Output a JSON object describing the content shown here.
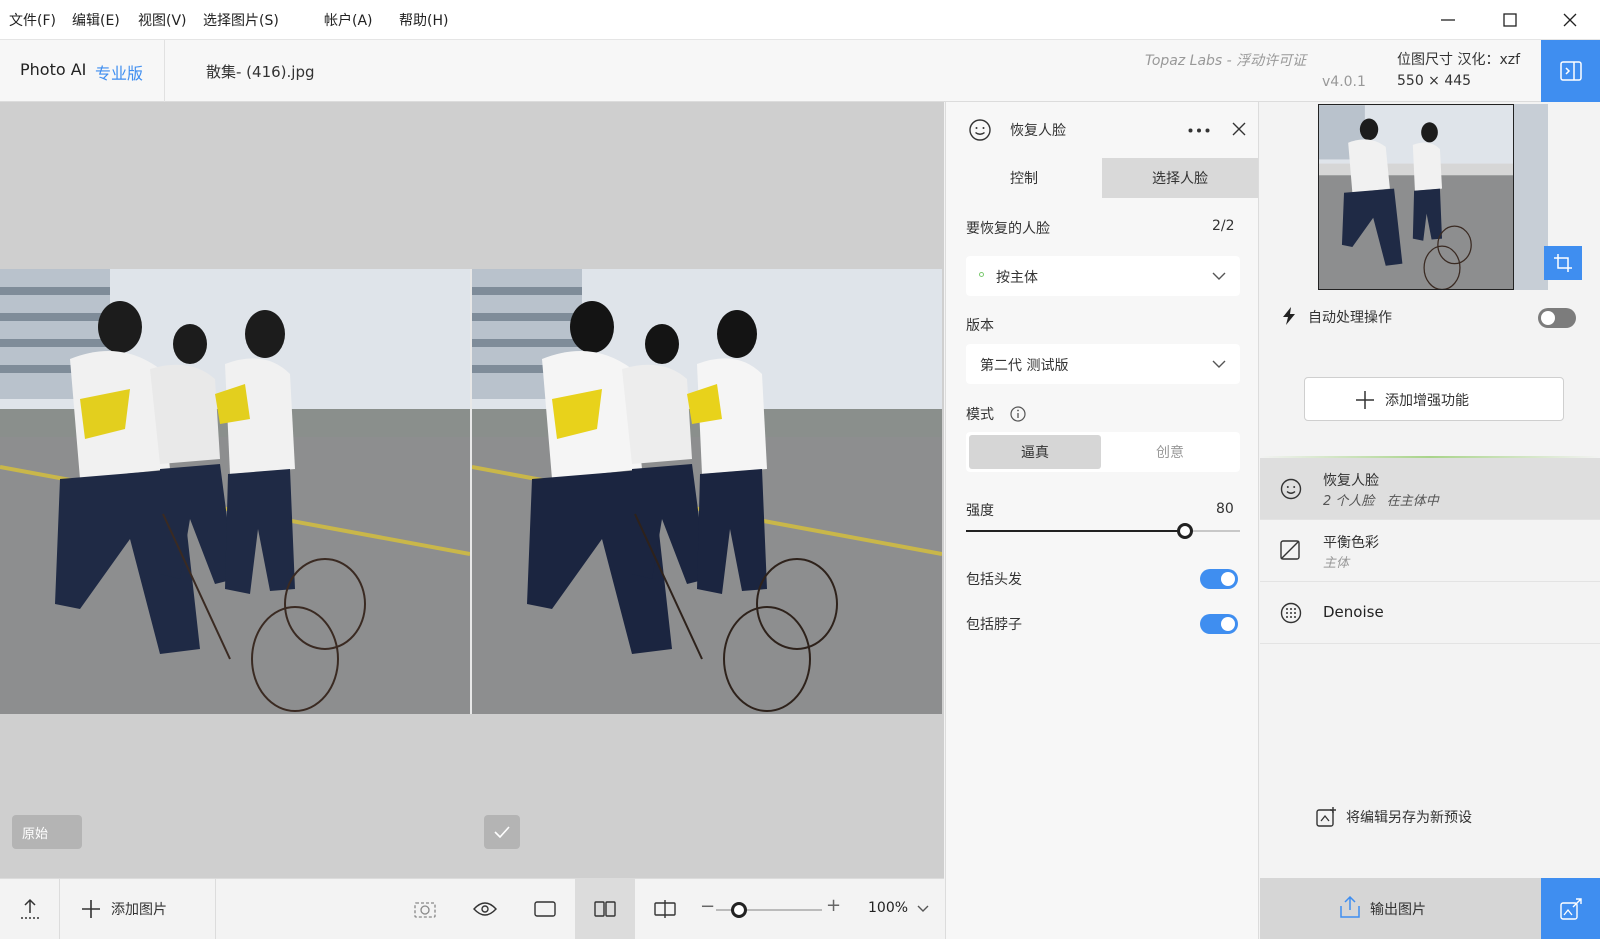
{
  "menu": {
    "file": "文件(F)",
    "edit": "编辑(E)",
    "view": "视图(V)",
    "select_image": "选择图片(S)",
    "account": "帐户(A)",
    "help": "帮助(H)"
  },
  "header": {
    "app_name": "Photo AI",
    "edition": "专业版",
    "file_name": "散集- (416).jpg",
    "license": "Topaz Labs - 浮动许可证",
    "version": "v4.0.1",
    "bitmap_label": "位图尺寸 汉化：xzf",
    "bitmap_size": "550 × 445"
  },
  "canvas": {
    "original_label": "原始"
  },
  "bottombar": {
    "add_image": "添加图片",
    "zoom": "100%",
    "zoom_slider_fraction": 0.22
  },
  "panel": {
    "title": "恢复人脸",
    "tabs": {
      "control": "控制",
      "select_face": "选择人脸"
    },
    "faces_label": "要恢复的人脸",
    "faces_count": "2/2",
    "face_mode_value": "按主体",
    "version_label": "版本",
    "version_value": "第二代 测试版",
    "mode_label": "模式",
    "mode_realistic": "逼真",
    "mode_creative": "创意",
    "strength_label": "强度",
    "strength_value": "80",
    "strength_fraction": 0.8,
    "include_hair": "包括头发",
    "include_neck": "包括脖子",
    "hair_on": true,
    "neck_on": true
  },
  "sidebar": {
    "autopilot": "自动处理操作",
    "add_enhancement": "添加增强功能",
    "enhancements": [
      {
        "title": "恢复人脸",
        "subtitle": "2 个人脸   在主体中"
      },
      {
        "title": "平衡色彩",
        "subtitle": "主体"
      },
      {
        "title": "Denoise",
        "subtitle": ""
      }
    ],
    "save_preset": "将编辑另存为新预设",
    "export": "输出图片"
  },
  "colors": {
    "accent": "#3f8ef0",
    "canvas_bg": "#cfcfcf",
    "selected_item": "#dedede"
  }
}
